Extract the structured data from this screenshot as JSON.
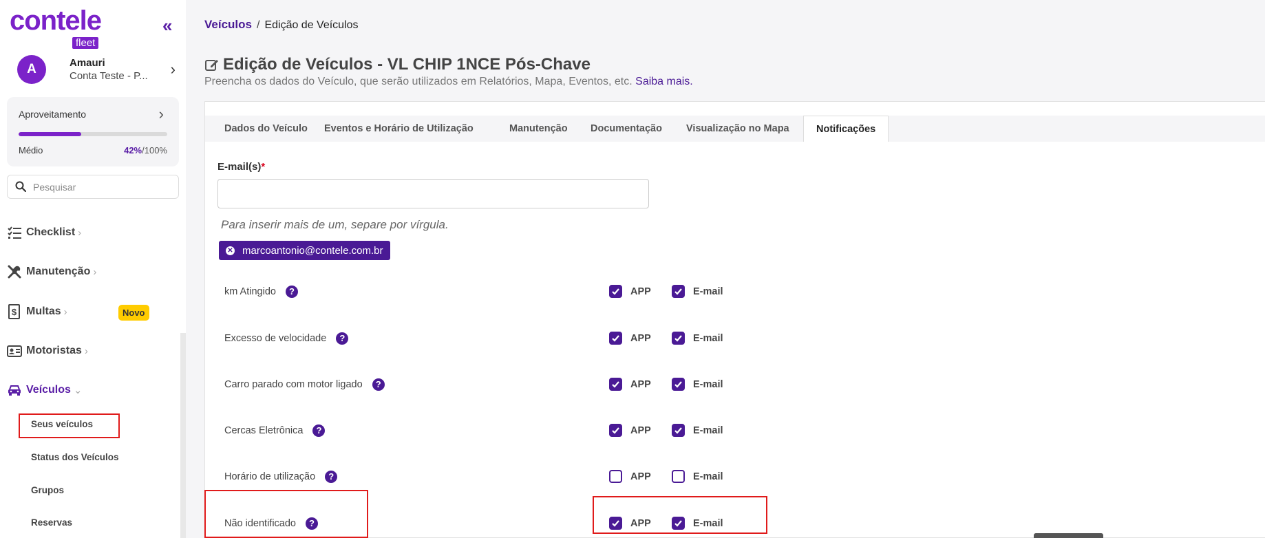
{
  "app": {
    "logo_text": "contele",
    "logo_sub": "fleet",
    "collapse_icon": "double-chevron-left-icon",
    "brand_color": "#7b22c9",
    "accent_color": "#4a1a95"
  },
  "user": {
    "initial": "A",
    "name": "Amauri",
    "account": "Conta Teste - P..."
  },
  "usage": {
    "title": "Aproveitamento",
    "level": "Médio",
    "percent": "42%",
    "total": "/100%",
    "fill_percent": 42
  },
  "search": {
    "placeholder": "Pesquisar"
  },
  "nav": {
    "checklist": "Checklist",
    "manutencao": "Manutenção",
    "multas": "Multas",
    "multas_badge": "Novo",
    "motoristas": "Motoristas",
    "veiculos": "Veículos",
    "sub": {
      "seus_veiculos": "Seus veículos",
      "status_veiculos": "Status dos Veículos",
      "grupos": "Grupos",
      "reservas": "Reservas"
    }
  },
  "breadcrumb": {
    "root": "Veículos",
    "separator": "/",
    "current": "Edição de Veículos"
  },
  "page": {
    "title": "Edição de Veículos - VL CHIP 1NCE Pós-Chave",
    "subtitle": "Preencha os dados do Veículo, que serão utilizados em Relatórios, Mapa, Eventos, etc.",
    "subtitle_link": "Saiba mais."
  },
  "tabs": [
    {
      "label": "Dados do Veículo",
      "active": false
    },
    {
      "label": "Eventos e Horário de Utilização",
      "active": false
    },
    {
      "label": "Manutenção",
      "active": false
    },
    {
      "label": "Documentação",
      "active": false
    },
    {
      "label": "Visualização no Mapa",
      "active": false
    },
    {
      "label": "Notificações",
      "active": true
    }
  ],
  "email": {
    "label": "E-mail(s)",
    "required_mark": "*",
    "value": "",
    "hint": "Para inserir mais de um, separe por vírgula.",
    "tag": "marcoantonio@contele.com.br"
  },
  "notifications": {
    "app_label": "APP",
    "email_label": "E-mail",
    "help_glyph": "?",
    "rows": [
      {
        "label": "km Atingido",
        "app": true,
        "email": true
      },
      {
        "label": "Excesso de velocidade",
        "app": true,
        "email": true
      },
      {
        "label": "Carro parado com motor ligado",
        "app": true,
        "email": true
      },
      {
        "label": "Cercas Eletrônica",
        "app": true,
        "email": true
      },
      {
        "label": "Horário de utilização",
        "app": false,
        "email": false
      },
      {
        "label": "Não identificado",
        "app": true,
        "email": true
      }
    ]
  }
}
